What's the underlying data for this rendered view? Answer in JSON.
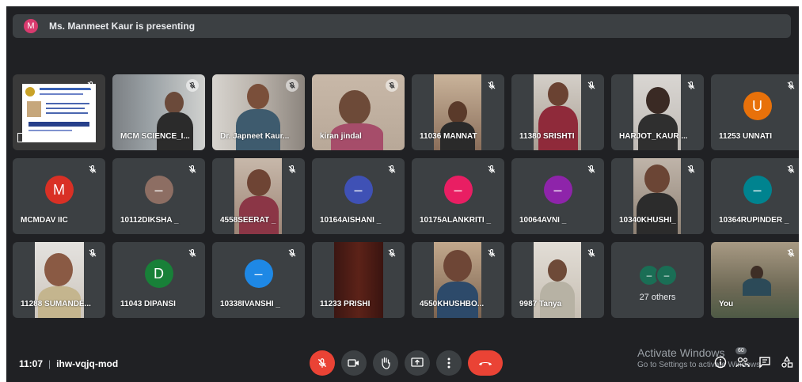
{
  "banner": {
    "initial": "M",
    "text": "Ms. Manmeet Kaur is presenting"
  },
  "tiles": [
    {
      "name": ""
    },
    {
      "name": "MCM SCIENCE_I..."
    },
    {
      "name": "Dr. Japneet Kaur..."
    },
    {
      "name": "kiran jindal"
    },
    {
      "name": "11036 MANNAT"
    },
    {
      "name": "11380 SRISHTI"
    },
    {
      "name": "HARJOT_KAUR ..."
    },
    {
      "name": "11253 UNNATI",
      "initial": "U"
    },
    {
      "name": "MCMDAV IIC",
      "initial": "M"
    },
    {
      "name": "10112DIKSHA _",
      "initial": "–"
    },
    {
      "name": "4558SEERAT _"
    },
    {
      "name": "10164AISHANI _",
      "initial": "–"
    },
    {
      "name": "10175ALANKRITI _",
      "initial": "–"
    },
    {
      "name": "10064AVNI _",
      "initial": "–"
    },
    {
      "name": "10340KHUSHI_"
    },
    {
      "name": "10364RUPINDER _",
      "initial": "–"
    },
    {
      "name": "11288 SUMANDE..."
    },
    {
      "name": "11043 DIPANSI",
      "initial": "D"
    },
    {
      "name": "10338IVANSHI _",
      "initial": "–"
    },
    {
      "name": "11233 PRISHI"
    },
    {
      "name": "4550KHUSHBO..."
    },
    {
      "name": "9987 Tanya"
    },
    {
      "name": "27 others",
      "dots": [
        "–",
        "–"
      ]
    },
    {
      "name": "You"
    }
  ],
  "colors": {
    "background": "#202124",
    "tile": "#3c4043",
    "end_call": "#ea4335",
    "presenter_avatar": "#d93a6e",
    "avatar_orange": "#e8710a",
    "avatar_red": "#d93025",
    "avatar_brown": "#8d6e63",
    "avatar_blue": "#3f51b5",
    "avatar_pink": "#e91e63",
    "avatar_purple": "#8e24aa",
    "avatar_teal": "#00838f",
    "avatar_green": "#188038",
    "avatar_lightblue": "#1e88e5",
    "avatar_others": "#1a6e55"
  },
  "footer": {
    "time": "11:07",
    "separator": "|",
    "meeting_code": "ihw-vqjq-mod",
    "participants_count": "60",
    "watermark_title": "Activate Windows",
    "watermark_sub": "Go to Settings to activate Windows."
  },
  "controls": [
    "mic-off-icon",
    "camera-icon",
    "raise-hand-icon",
    "present-screen-icon",
    "more-options-icon",
    "end-call-icon"
  ],
  "side_icons": [
    "info-icon",
    "people-icon",
    "chat-icon",
    "activities-icon"
  ]
}
